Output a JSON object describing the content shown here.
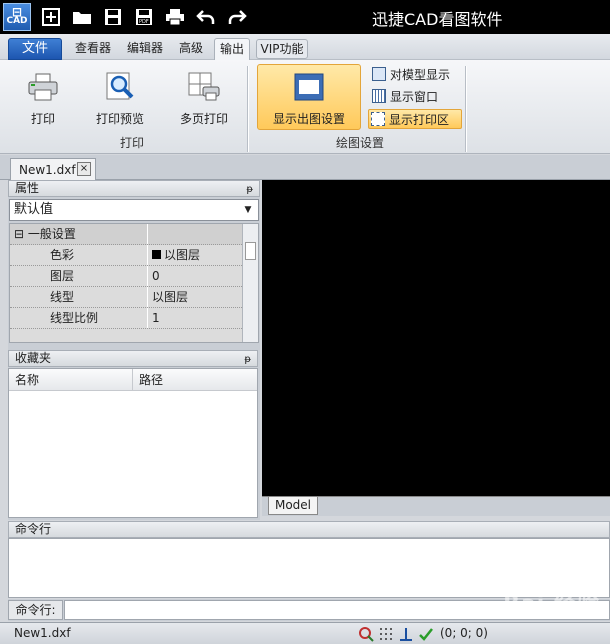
{
  "app": {
    "title": "迅捷CAD看图软件",
    "logo_text": "CAD"
  },
  "quick_access": [
    "new-icon",
    "open-folder-icon",
    "save-icon",
    "save-as-pdf-icon",
    "print-icon",
    "undo-icon",
    "redo-icon"
  ],
  "ribbon_tabs": [
    {
      "label": "文件"
    },
    {
      "label": "查看器"
    },
    {
      "label": "编辑器"
    },
    {
      "label": "高级"
    },
    {
      "label": "输出",
      "active": true
    },
    {
      "label": "VIP功能"
    }
  ],
  "ribbon": {
    "print": "打印",
    "print_preview": "打印预览",
    "multi_page_print": "多页打印",
    "group_print": "打印",
    "show_plot_settings": "显示出图设置",
    "show_model": "对模型显示",
    "show_window": "显示窗口",
    "show_print_area": "显示打印区",
    "group_plot_settings": "绘图设置"
  },
  "document": {
    "tab": "New1.dxf",
    "close": "×"
  },
  "properties": {
    "title": "属性",
    "pin": "ᵽ",
    "selected": "默认值",
    "group": "一般设置",
    "group_toggle": "⊟",
    "rows": [
      {
        "key": "色彩",
        "value": "以图层",
        "swatch": "#000000"
      },
      {
        "key": "图层",
        "value": "0"
      },
      {
        "key": "线型",
        "value": "以图层"
      },
      {
        "key": "线型比例",
        "value": "1"
      }
    ]
  },
  "favorites": {
    "title": "收藏夹",
    "pin": "ᵽ",
    "col_name": "名称",
    "col_path": "路径"
  },
  "canvas": {
    "model_tab": "Model",
    "background": "#000000"
  },
  "command": {
    "title": "命令行",
    "label": "命令行:",
    "value": ""
  },
  "status": {
    "file": "New1.dxf",
    "coords": "(0; 0; 0)",
    "icons": [
      "osnap-icon",
      "grid-icon",
      "ortho-icon",
      "polar-icon"
    ]
  },
  "watermark": "Bai 经验"
}
